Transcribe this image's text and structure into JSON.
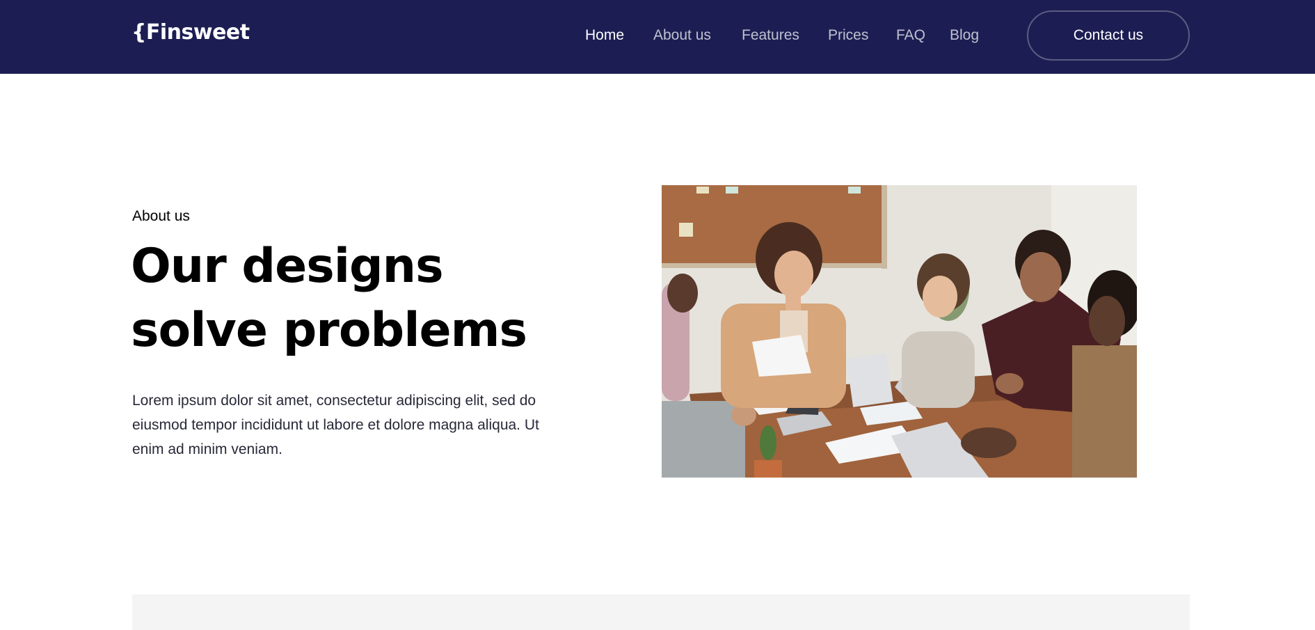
{
  "header": {
    "logo_text": "{Finsweet",
    "nav": [
      {
        "label": "Home",
        "active": true
      },
      {
        "label": "About us",
        "active": false
      },
      {
        "label": "Features",
        "active": false
      },
      {
        "label": "Prices",
        "active": false
      },
      {
        "label": "FAQ",
        "active": false
      },
      {
        "label": "Blog",
        "active": false
      }
    ],
    "cta_label": "Contact us"
  },
  "hero": {
    "eyebrow": "About us",
    "title": "Our designs solve problems",
    "body": "Lorem ipsum dolor sit amet, consectetur adipiscing elit, sed do eiusmod tempor incididunt ut labore et dolore magna aliqua. Ut enim ad minim veniam.",
    "image_description": "team-meeting-photo"
  },
  "colors": {
    "navbar_bg": "#1c1e53",
    "text_dark": "#282938",
    "section_grey": "#f3f4f3",
    "white": "#ffffff"
  }
}
